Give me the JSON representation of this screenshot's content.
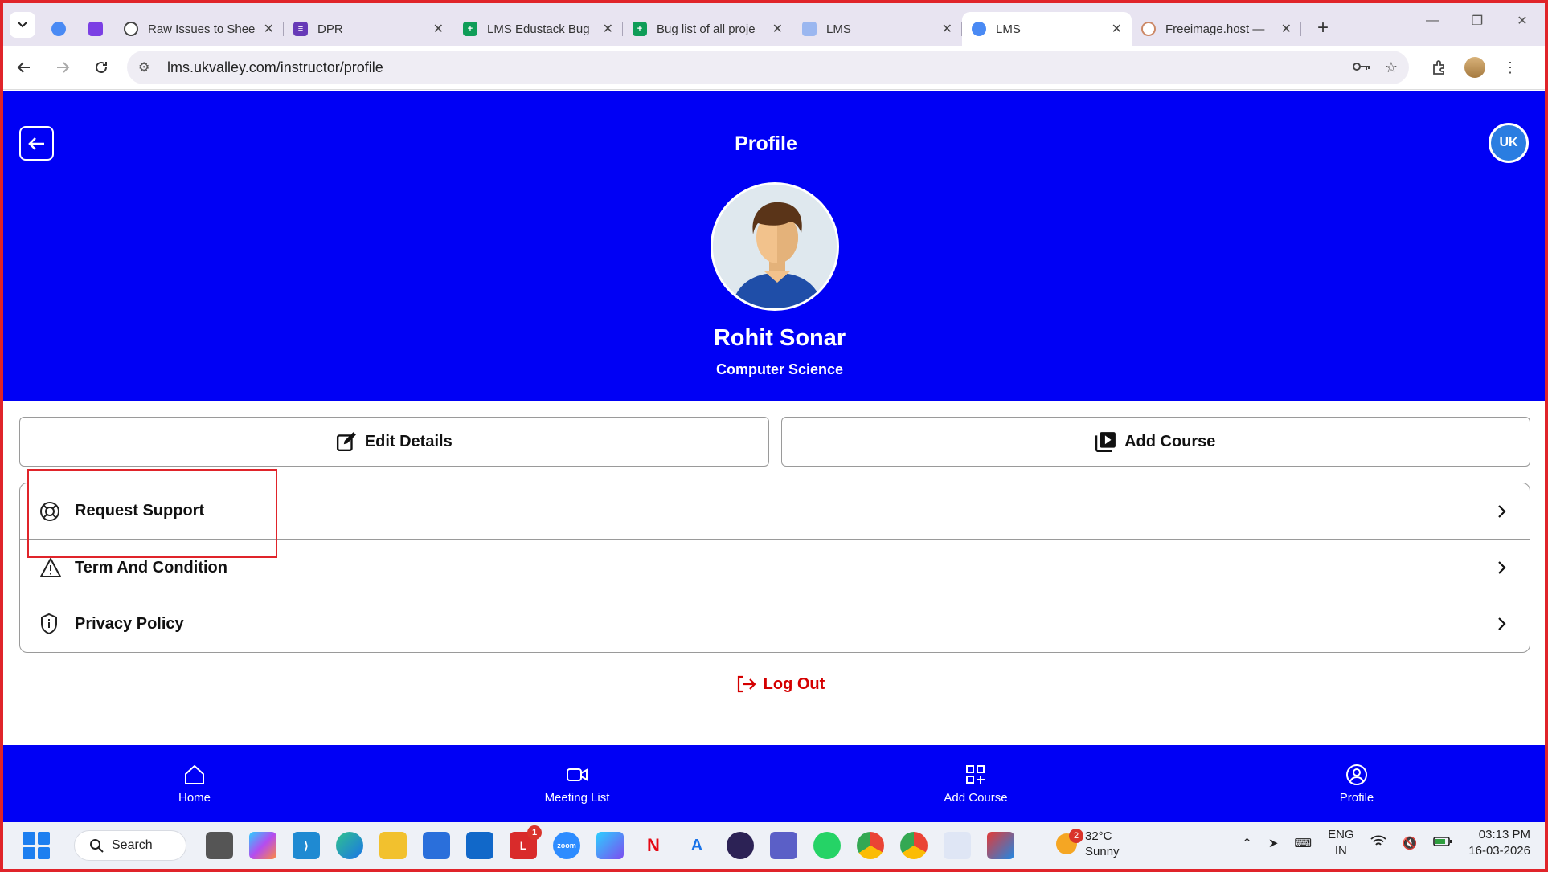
{
  "browser": {
    "tabs": [
      {
        "title": "",
        "favicon_color": "#4a8af4",
        "pinned": true
      },
      {
        "title": "",
        "favicon_color": "#7b3fe4",
        "pinned": true
      },
      {
        "title": "Raw Issues to Shee",
        "favicon_color": "#444444"
      },
      {
        "title": "DPR",
        "favicon_color": "#673ab7"
      },
      {
        "title": "LMS Edustack Bug",
        "favicon_color": "#0f9d58"
      },
      {
        "title": "Bug list of all proje",
        "favicon_color": "#0f9d58"
      },
      {
        "title": "LMS",
        "favicon_color": "#4a8af4"
      },
      {
        "title": "LMS",
        "favicon_color": "#4a8af4",
        "active": true
      },
      {
        "title": "Freeimage.host —",
        "favicon_color": "#cc8866"
      }
    ],
    "url": "lms.ukvalley.com/instructor/profile"
  },
  "page": {
    "title": "Profile",
    "logo_text": "UK",
    "user_name": "Rohit Sonar",
    "department": "Computer Science",
    "edit_label": "Edit Details",
    "add_course_label": "Add Course",
    "menu": {
      "request_support": "Request Support",
      "terms": "Term And Condition",
      "privacy": "Privacy Policy"
    },
    "logout_label": "Log Out",
    "colors": {
      "primary": "#0000f5",
      "logout": "#d40000",
      "highlight": "#e0242a"
    }
  },
  "bottom_nav": {
    "home": "Home",
    "meetings": "Meeting List",
    "add_course": "Add Course",
    "profile": "Profile"
  },
  "taskbar": {
    "search_label": "Search",
    "notification_badge": "1",
    "weather_badge": "2",
    "temperature": "32°C",
    "weather": "Sunny",
    "lang_line1": "ENG",
    "lang_line2": "IN",
    "time": "03:13 PM",
    "date": "16-03-2026"
  }
}
